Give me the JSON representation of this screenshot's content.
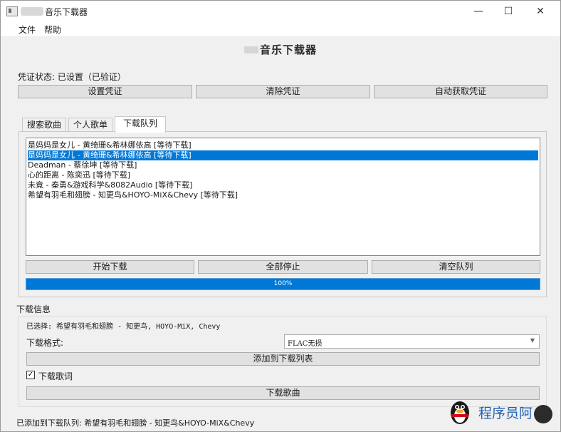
{
  "window": {
    "title": "音乐下载器",
    "minimize_glyph": "—",
    "maximize_glyph": "☐",
    "close_glyph": "✕"
  },
  "menu": [
    "文件",
    "帮助"
  ],
  "heading": "音乐下载器",
  "credentials": {
    "status": "凭证状态: 已设置（已验证）",
    "buttons": [
      "设置凭证",
      "清除凭证",
      "自动获取凭证"
    ]
  },
  "tabs": [
    "搜索歌曲",
    "个人歌单",
    "下载队列"
  ],
  "active_tab": "下载队列",
  "queue": {
    "items": [
      "是妈妈是女儿 - 黄绮珊&希林娜依高 [等待下载]",
      "是妈妈是女儿 - 黄绮珊&希林娜依高 [等待下载]",
      "Deadman - 蔡徐坤 [等待下载]",
      "心的距离 - 陈奕迅 [等待下载]",
      "未竟 - 秦勇&游戏科学&8082Audio [等待下载]",
      "希望有羽毛和翅膀 - 知更鸟&HOYO-MiX&Chevy [等待下载]"
    ],
    "selected_index": 1,
    "buttons": [
      "开始下载",
      "全部停止",
      "清空队列"
    ],
    "progress_label": "100%",
    "progress_value": 1.0
  },
  "download_info": {
    "section_label": "下载信息",
    "selected": "已选择: 希望有羽毛和翅膀 - 知更鸟, HOYO-MiX, Chevy",
    "format_label": "下载格式:",
    "format_value": "FLAC无损",
    "add_button": "添加到下载列表",
    "lyrics_checkbox_label": "下载歌词",
    "lyrics_checked": true,
    "checkbox_mark": "✓",
    "combo_arrow": "▼",
    "lyrics_button": "下载歌曲"
  },
  "status_bar": "已添加到下载队列: 希望有羽毛和翅膀 - 知更鸟&HOYO-MiX&Chevy",
  "watermark": "程序员阿",
  "colors": {
    "selection": "#0078d7",
    "progress": "#0078d7",
    "window_bg": "#f0f0f0"
  }
}
